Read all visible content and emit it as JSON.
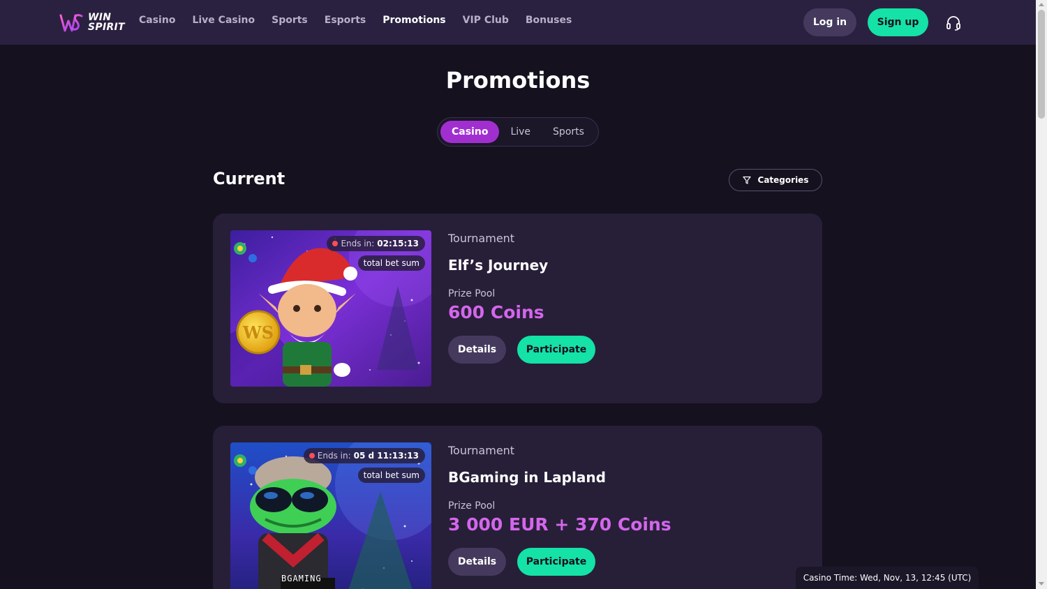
{
  "brand": {
    "line1": "WIN",
    "line2": "SPIRIT"
  },
  "nav": [
    {
      "label": "Casino",
      "active": false
    },
    {
      "label": "Live Casino",
      "active": false
    },
    {
      "label": "Sports",
      "active": false
    },
    {
      "label": "Esports",
      "active": false
    },
    {
      "label": "Promotions",
      "active": true
    },
    {
      "label": "VIP Club",
      "active": false
    },
    {
      "label": "Bonuses",
      "active": false
    }
  ],
  "auth": {
    "login": "Log in",
    "signup": "Sign up"
  },
  "page": {
    "title": "Promotions"
  },
  "tabs": [
    {
      "label": "Casino",
      "active": true
    },
    {
      "label": "Live",
      "active": false
    },
    {
      "label": "Sports",
      "active": false
    }
  ],
  "section": {
    "title": "Current",
    "categories_label": "Categories"
  },
  "promotions": [
    {
      "ends_label": "Ends in:",
      "ends_value": "02:15:13",
      "tag": "total bet sum",
      "category": "Tournament",
      "title": "Elf’s Journey",
      "prize_label": "Prize Pool",
      "prize_value": "600 Coins",
      "details_label": "Details",
      "participate_label": "Participate"
    },
    {
      "ends_label": "Ends in:",
      "ends_value": "05 d 11:13:13",
      "tag": "total bet sum",
      "category": "Tournament",
      "title": "BGaming in Lapland",
      "prize_label": "Prize Pool",
      "prize_value": "3 000 EUR + 370 Coins",
      "details_label": "Details",
      "participate_label": "Participate",
      "provider_watermark": "BGAMING"
    }
  ],
  "footer": {
    "casino_time": "Casino Time: Wed, Nov, 13, 12:45 (UTC)"
  },
  "colors": {
    "background": "#15111f",
    "header": "#2a2140",
    "card": "#271f38",
    "accent_purple": "#a12fd0",
    "prize_pink": "#d466ec",
    "accent_green": "#14e2a6"
  }
}
